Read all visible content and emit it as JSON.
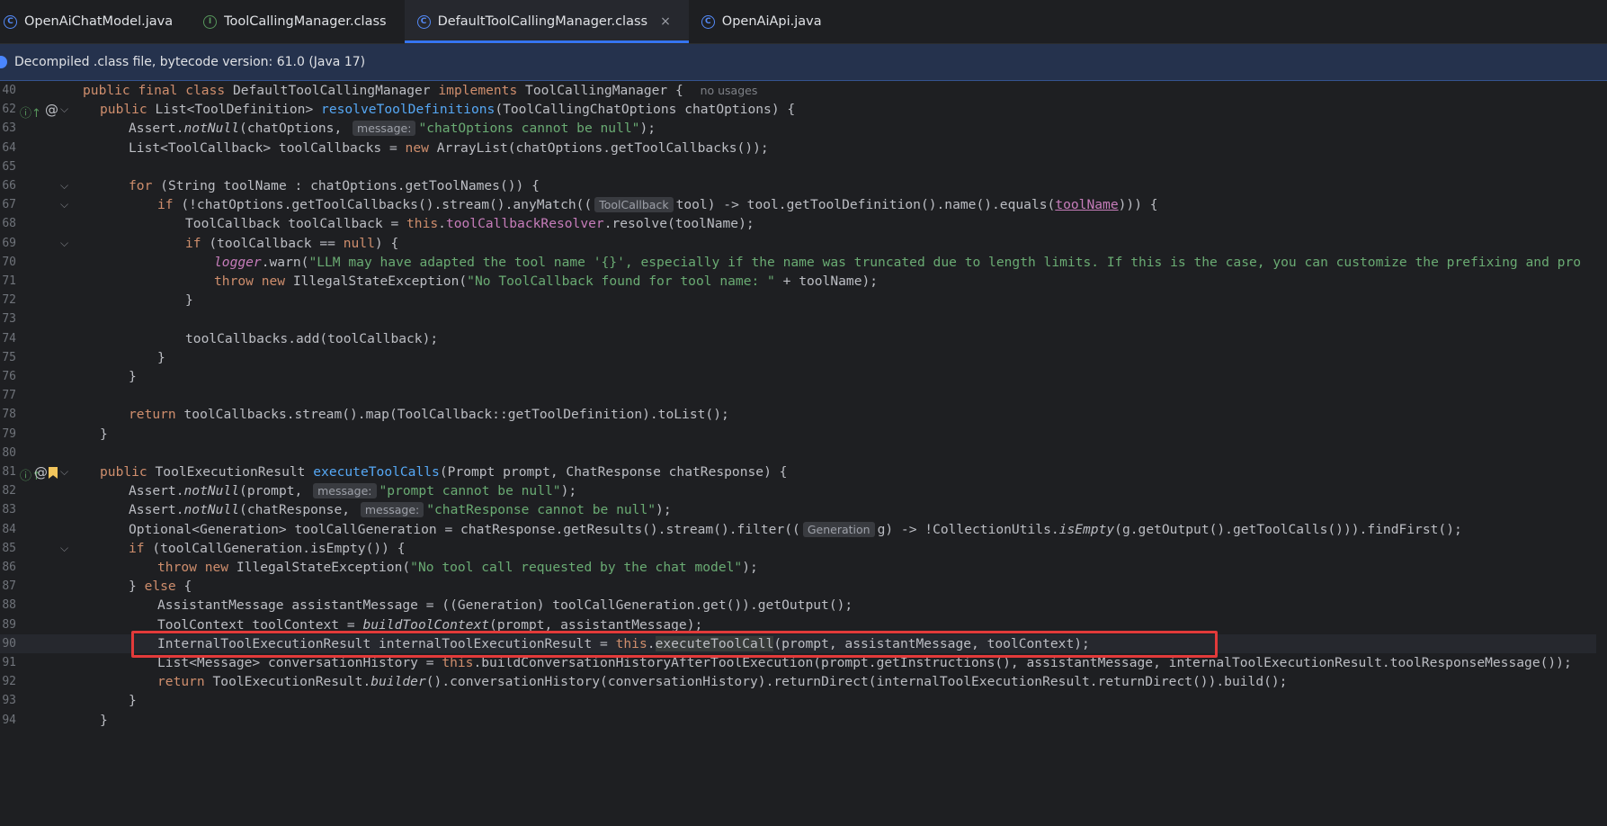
{
  "tabs": [
    {
      "label": "OpenAiChatModel.java",
      "icon": "class-icon",
      "active": false
    },
    {
      "label": "ToolCallingManager.class",
      "icon": "interface-icon",
      "active": false
    },
    {
      "label": "DefaultToolCallingManager.class",
      "icon": "class-file-icon",
      "active": true
    },
    {
      "label": "OpenAiApi.java",
      "icon": "class-icon",
      "active": false
    }
  ],
  "tab_close_glyph": "×",
  "banner": {
    "text": "Decompiled .class file, bytecode version: 61.0 (Java 17)"
  },
  "inlays": {
    "message": "message:",
    "toolcallback": "ToolCallback",
    "generation": "Generation",
    "no_usages": "no usages"
  },
  "lines": [
    {
      "n": "40",
      "t": "public final class DefaultToolCallingManager implements ToolCallingManager {"
    },
    {
      "n": "62",
      "t": "public List<ToolDefinition> resolveToolDefinitions(ToolCallingChatOptions chatOptions) {"
    },
    {
      "n": "63",
      "t": "Assert.notNull(chatOptions, \"chatOptions cannot be null\");"
    },
    {
      "n": "64",
      "t": "List<ToolCallback> toolCallbacks = new ArrayList(chatOptions.getToolCallbacks());"
    },
    {
      "n": "65",
      "t": ""
    },
    {
      "n": "66",
      "t": "for (String toolName : chatOptions.getToolNames()) {"
    },
    {
      "n": "67",
      "t": "if (!chatOptions.getToolCallbacks().stream().anyMatch((tool) -> tool.getToolDefinition().name().equals(toolName))) {"
    },
    {
      "n": "68",
      "t": "ToolCallback toolCallback = this.toolCallbackResolver.resolve(toolName);"
    },
    {
      "n": "69",
      "t": "if (toolCallback == null) {"
    },
    {
      "n": "70",
      "t": "logger.warn(\"LLM may have adapted the tool name '{}', especially if the name was truncated due to length limits. If this is the case, you can customize the prefixing and pro"
    },
    {
      "n": "71",
      "t": "throw new IllegalStateException(\"No ToolCallback found for tool name: \" + toolName);"
    },
    {
      "n": "72",
      "t": "}"
    },
    {
      "n": "73",
      "t": ""
    },
    {
      "n": "74",
      "t": "toolCallbacks.add(toolCallback);"
    },
    {
      "n": "75",
      "t": "}"
    },
    {
      "n": "76",
      "t": "}"
    },
    {
      "n": "77",
      "t": ""
    },
    {
      "n": "78",
      "t": "return toolCallbacks.stream().map(ToolCallback::getToolDefinition).toList();"
    },
    {
      "n": "79",
      "t": "}"
    },
    {
      "n": "80",
      "t": ""
    },
    {
      "n": "81",
      "t": "public ToolExecutionResult executeToolCalls(Prompt prompt, ChatResponse chatResponse) {"
    },
    {
      "n": "82",
      "t": "Assert.notNull(prompt, \"prompt cannot be null\");"
    },
    {
      "n": "83",
      "t": "Assert.notNull(chatResponse, \"chatResponse cannot be null\");"
    },
    {
      "n": "84",
      "t": "Optional<Generation> toolCallGeneration = chatResponse.getResults().stream().filter((g) -> !CollectionUtils.isEmpty(g.getOutput().getToolCalls())).findFirst();"
    },
    {
      "n": "85",
      "t": "if (toolCallGeneration.isEmpty()) {"
    },
    {
      "n": "86",
      "t": "throw new IllegalStateException(\"No tool call requested by the chat model\");"
    },
    {
      "n": "87",
      "t": "} else {"
    },
    {
      "n": "88",
      "t": "AssistantMessage assistantMessage = ((Generation) toolCallGeneration.get()).getOutput();"
    },
    {
      "n": "89",
      "t": "ToolContext toolContext = buildToolContext(prompt, assistantMessage);"
    },
    {
      "n": "90",
      "t": "InternalToolExecutionResult internalToolExecutionResult = this.executeToolCall(prompt, assistantMessage, toolContext);"
    },
    {
      "n": "91",
      "t": "List<Message> conversationHistory = this.buildConversationHistoryAfterToolExecution(prompt.getInstructions(), assistantMessage, internalToolExecutionResult.toolResponseMessage());"
    },
    {
      "n": "92",
      "t": "return ToolExecutionResult.builder().conversationHistory(conversationHistory).returnDirect(internalToolExecutionResult.returnDirect()).build();"
    },
    {
      "n": "93",
      "t": "}"
    },
    {
      "n": "94",
      "t": "}"
    }
  ]
}
